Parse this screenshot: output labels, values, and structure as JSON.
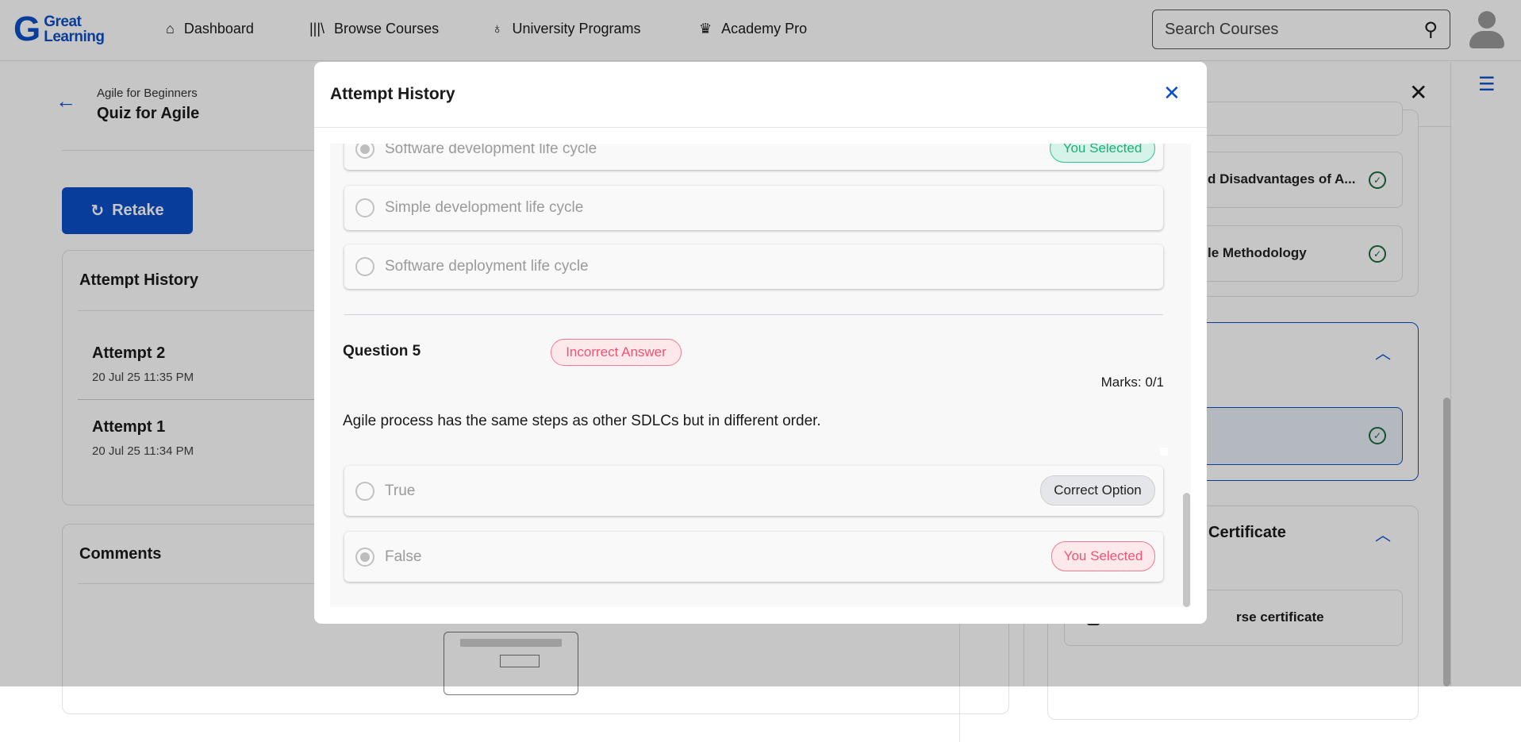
{
  "nav": {
    "logo": "Great Learning",
    "items": [
      {
        "label": "Dashboard",
        "icon": "home-icon"
      },
      {
        "label": "Browse Courses",
        "icon": "library-icon"
      },
      {
        "label": "University Programs",
        "icon": "award-icon"
      },
      {
        "label": "Academy Pro",
        "icon": "crown-icon"
      }
    ],
    "search_placeholder": "Search Courses"
  },
  "left": {
    "breadcrumb": "Agile for Beginners",
    "title": "Quiz for Agile",
    "retake": "Retake",
    "attempt_history_title": "Attempt History",
    "attempts": [
      {
        "label": "Attempt 2",
        "date": "20 Jul 25 11:35 PM"
      },
      {
        "label": "Attempt 1",
        "date": "20 Jul 25 11:34 PM"
      }
    ],
    "comments_title": "Comments"
  },
  "right": {
    "items": [
      "d Disadvantages of A...",
      "le Methodology"
    ],
    "certificate_title": "Certificate",
    "certificate_item": "rse certificate"
  },
  "modal": {
    "title": "Attempt History",
    "prev_options": [
      {
        "text": "Software development life cycle",
        "selected": true,
        "badge": "You Selected"
      },
      {
        "text": "Simple development life cycle"
      },
      {
        "text": "Software deployment life cycle"
      }
    ],
    "question": {
      "label": "Question 5",
      "status": "Incorrect Answer",
      "marks": "Marks: 0/1",
      "text": "Agile process has the same steps as other SDLCs but in different order.",
      "options": [
        {
          "text": "True",
          "badge": "Correct Option"
        },
        {
          "text": "False",
          "selected": true,
          "badge": "You Selected"
        }
      ]
    }
  },
  "colors": {
    "brand": "#0b4fc8",
    "correct": "#1fae7b",
    "incorrect": "#f05473"
  }
}
